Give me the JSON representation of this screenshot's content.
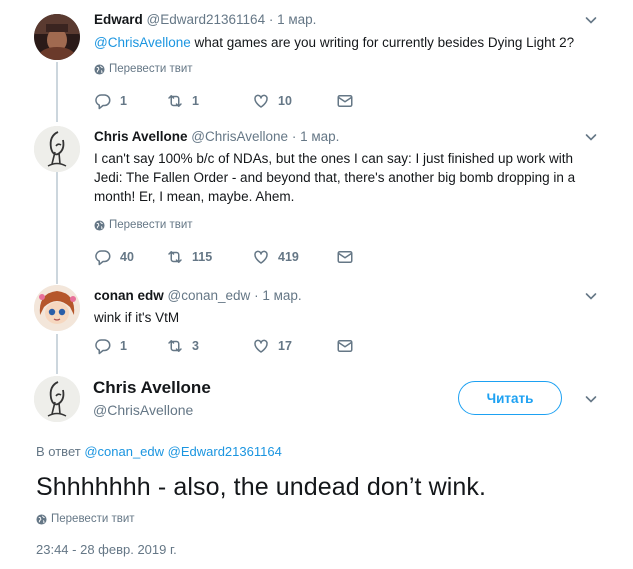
{
  "tweets": [
    {
      "name": "Edward",
      "handle": "@Edward21361164",
      "separator": "·",
      "date": "1 мар.",
      "mention": "@ChrisAvellone",
      "text": " what games are you writing for currently besides Dying Light 2?",
      "translate": "Перевести твит",
      "replies": "1",
      "retweets": "1",
      "likes": "10"
    },
    {
      "name": "Chris Avellone",
      "handle": "@ChrisAvellone",
      "separator": "·",
      "date": "1 мар.",
      "text": "I can't say 100% b/c of NDAs, but the ones I can say: I just finished up work with Jedi: The Fallen Order - and beyond that, there's another big bomb dropping in a month! Er, I mean, maybe. Ahem.",
      "translate": "Перевести твит",
      "replies": "40",
      "retweets": "115",
      "likes": "419"
    },
    {
      "name": "conan edw",
      "handle": "@conan_edw",
      "separator": "·",
      "date": "1 мар.",
      "text": "wink if it's VtM",
      "replies": "1",
      "retweets": "3",
      "likes": "17"
    }
  ],
  "main_tweet": {
    "name": "Chris Avellone",
    "handle": "@ChrisAvellone",
    "follow_label": "Читать",
    "reply_prefix": "В ответ",
    "reply_mention_1": "@conan_edw",
    "reply_mention_2": "@Edward21361164",
    "text": "Shhhhhhh - also, the undead don’t wink.",
    "translate": "Перевести твит",
    "timestamp": "23:44 - 28 февр. 2019 г."
  },
  "colors": {
    "accent": "#1da1f2",
    "mention": "#1b95e0",
    "muted": "#657786",
    "thread_line": "#ccd6dd"
  },
  "icons": [
    "chevron-down-icon",
    "globe-icon",
    "reply-icon",
    "retweet-icon",
    "like-icon",
    "direct-message-icon"
  ]
}
